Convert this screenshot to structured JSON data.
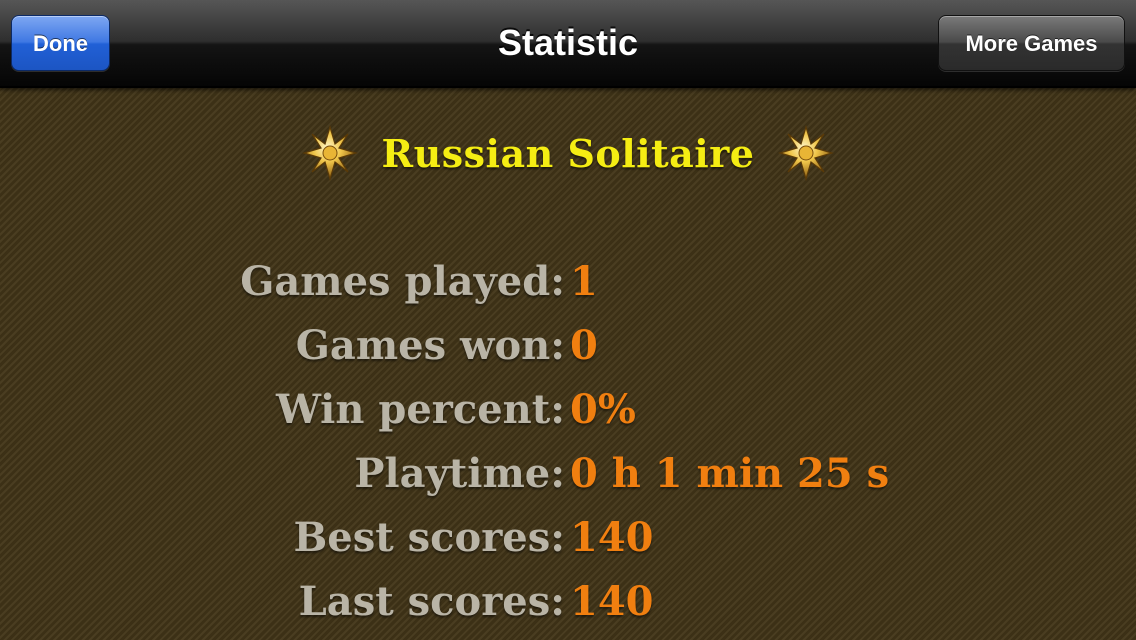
{
  "navbar": {
    "title": "Statistic",
    "done_label": "Done",
    "more_games_label": "More Games"
  },
  "game": {
    "title": "Russian Solitaire",
    "left_icon": "gold-star-icon",
    "right_icon": "gold-star-icon"
  },
  "stats": [
    {
      "label": "Games played:",
      "value": "1"
    },
    {
      "label": "Games won:",
      "value": "0"
    },
    {
      "label": "Win percent:",
      "value": "0%"
    },
    {
      "label": "Playtime:",
      "value": "0 h 1 min 25 s"
    },
    {
      "label": "Best scores:",
      "value": "140"
    },
    {
      "label": "Last scores:",
      "value": "140"
    }
  ],
  "colors": {
    "title_yellow": "#f5ed13",
    "label_gray": "#b9b4a6",
    "value_orange": "#f07f10",
    "background_brown": "#433619",
    "done_blue": "#2160d6"
  }
}
